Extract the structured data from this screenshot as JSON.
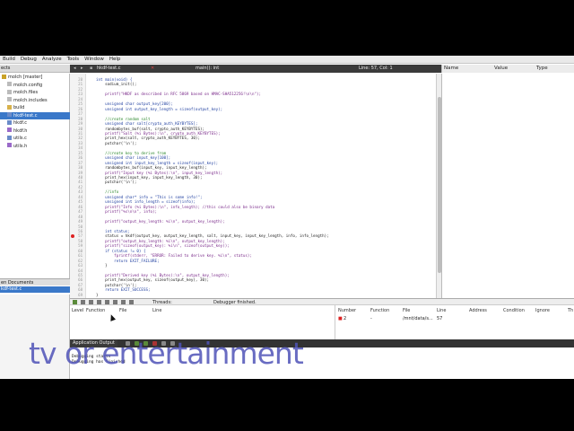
{
  "menu": [
    "Build",
    "Debug",
    "Analyze",
    "Tools",
    "Window",
    "Help"
  ],
  "projects": {
    "header": "ects",
    "items": [
      {
        "label": "molch [master]",
        "icon": "project-icon"
      },
      {
        "label": "molch.config",
        "icon": "file-icon"
      },
      {
        "label": "molch.files",
        "icon": "file-icon"
      },
      {
        "label": "molch.includes",
        "icon": "file-icon"
      },
      {
        "label": "build",
        "icon": "folder-icon"
      },
      {
        "label": "hkdf-test.c",
        "icon": "c-file-icon"
      },
      {
        "label": "hkdf.c",
        "icon": "c-file-icon"
      },
      {
        "label": "hkdf.h",
        "icon": "h-file-icon"
      },
      {
        "label": "utils.c",
        "icon": "c-file-icon"
      },
      {
        "label": "utils.h",
        "icon": "h-file-icon"
      }
    ]
  },
  "open_documents": {
    "header": "en Documents",
    "items": [
      "kdf-test.c"
    ]
  },
  "editor": {
    "filename": "hkdf-test.c",
    "symbol": "main(): int",
    "position": "Line: 57, Col: 1",
    "lines": [
      {
        "n": "20",
        "t": "int main(void) {"
      },
      {
        "n": "21",
        "t": "    sodium_init();"
      },
      {
        "n": "22",
        "t": ""
      },
      {
        "n": "23",
        "t": "    printf(\"HKDF as described in RFC 5869 based on HMAC-SHA512256!\\n\\n\");"
      },
      {
        "n": "24",
        "t": ""
      },
      {
        "n": "25",
        "t": "    unsigned char output_key[200];"
      },
      {
        "n": "26",
        "t": "    unsigned int output_key_length = sizeof(output_key);"
      },
      {
        "n": "27",
        "t": ""
      },
      {
        "n": "28",
        "t": "    //create random salt"
      },
      {
        "n": "29",
        "t": "    unsigned char salt[crypto_auth_KEYBYTES];"
      },
      {
        "n": "30",
        "t": "    randombytes_buf(salt, crypto_auth_KEYBYTES);"
      },
      {
        "n": "31",
        "t": "    printf(\"Salt (%i Bytes):\\n\", crypto_auth_KEYBYTES);"
      },
      {
        "n": "32",
        "t": "    print_hex(salt, crypto_auth_KEYBYTES, 30);"
      },
      {
        "n": "33",
        "t": "    putchar('\\n');"
      },
      {
        "n": "34",
        "t": ""
      },
      {
        "n": "35",
        "t": "    //create key to derive from"
      },
      {
        "n": "36",
        "t": "    unsigned char input_key[100];"
      },
      {
        "n": "37",
        "t": "    unsigned int input_key_length = sizeof(input_key);"
      },
      {
        "n": "38",
        "t": "    randombytes_buf(input_key, input_key_length);"
      },
      {
        "n": "39",
        "t": "    printf(\"Input key (%i Bytes):\\n\", input_key_length);"
      },
      {
        "n": "40",
        "t": "    print_hex(input_key, input_key_length, 30);"
      },
      {
        "n": "41",
        "t": "    putchar('\\n');"
      },
      {
        "n": "42",
        "t": ""
      },
      {
        "n": "43",
        "t": "    //info"
      },
      {
        "n": "44",
        "t": "    unsigned char* info = \"This is some info!\";"
      },
      {
        "n": "45",
        "t": "    unsigned int info_length = sizeof(info);"
      },
      {
        "n": "46",
        "t": "    printf(\"Info (%i Bytes):\\n\", info_length); //this could also be binary data"
      },
      {
        "n": "47",
        "t": "    printf(\"%s\\n\\n\", info);"
      },
      {
        "n": "48",
        "t": ""
      },
      {
        "n": "49",
        "t": "    printf(\"output_key_length: %i\\n\", output_key_length);"
      },
      {
        "n": "50",
        "t": ""
      },
      {
        "n": "56",
        "t": "    int status;"
      },
      {
        "n": "57",
        "t": "    status = hkdf(output_key, output_key_length, salt, input_key, input_key_length, info, info_length);"
      },
      {
        "n": "58",
        "t": "    printf(\"output_key_length: %i\\n\", output_key_length);"
      },
      {
        "n": "59",
        "t": "    printf(\"sizeof(output_key): %i\\n\", sizeof(output_key));"
      },
      {
        "n": "60",
        "t": "    if (status != 0) {"
      },
      {
        "n": "61",
        "t": "        fprintf(stderr, \"ERROR: Failed to derive key. %i\\n\", status);"
      },
      {
        "n": "62",
        "t": "        return EXIT_FAILURE;"
      },
      {
        "n": "63",
        "t": "    }"
      },
      {
        "n": "64",
        "t": ""
      },
      {
        "n": "65",
        "t": "    printf(\"Derived key (%i Bytes):\\n\", output_key_length);"
      },
      {
        "n": "66",
        "t": "    print_hex(output_key, sizeof(output_key), 30);"
      },
      {
        "n": "67",
        "t": "    putchar('\\n');"
      },
      {
        "n": "68",
        "t": "    return EXIT_SUCCESS;"
      },
      {
        "n": "69",
        "t": "}"
      }
    ]
  },
  "locals": {
    "columns": [
      "Name",
      "Value",
      "Type"
    ]
  },
  "debugger": {
    "threads_label": "Threads:",
    "status": "Debugger finished."
  },
  "stack": {
    "columns": [
      "Level",
      "Function",
      "File",
      "Line"
    ]
  },
  "breakpoints": {
    "columns": [
      "Number",
      "Function",
      "File",
      "Line",
      "Address",
      "Condition",
      "Ignore",
      "Th"
    ],
    "rows": [
      {
        "number": "2",
        "function": "-",
        "file": "/mnt/data/s...",
        "line": "57"
      }
    ]
  },
  "output": {
    "tab": "Application Output",
    "lines": [
      "Debugging starts",
      "Debugging has finished"
    ]
  },
  "watermark": "tv or entertainment",
  "colors": {
    "selection": "#3a78c9",
    "breakpoint": "#d22222",
    "watermark": "#4f53b8"
  }
}
